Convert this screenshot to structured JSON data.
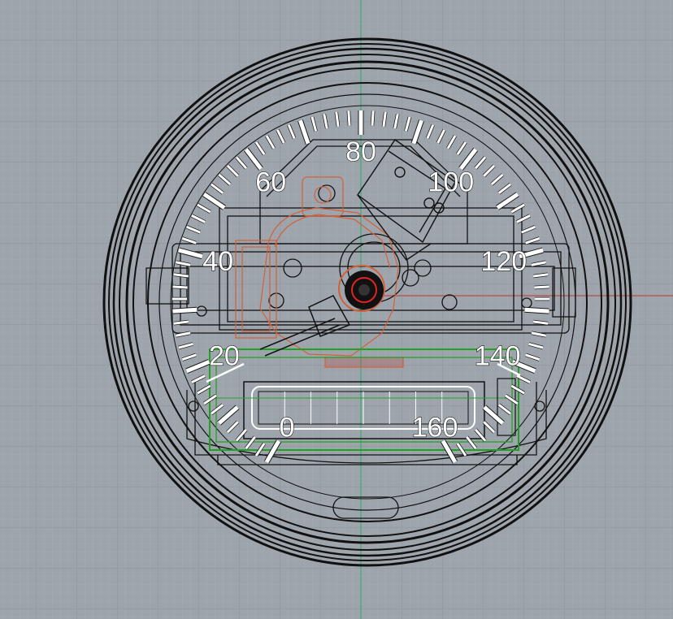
{
  "viewport": {
    "background": "#9ea4ac",
    "grid_minor": "#aab0b7",
    "grid_major": "#8d939b",
    "axis_x_color": "#c0392b",
    "axis_y_color": "#27ae60"
  },
  "gauge": {
    "labels": [
      "0",
      "20",
      "40",
      "60",
      "80",
      "100",
      "120",
      "140",
      "160"
    ],
    "values": [
      0,
      20,
      40,
      60,
      80,
      100,
      120,
      140,
      160
    ],
    "max_value": 160,
    "minor_tick_step": 2,
    "major_tick_step": 10,
    "tick_color": "#ffffff",
    "wire_color": "#111111",
    "mechanism_color": "#d2603a",
    "display_frame_color": "#1fa31f"
  }
}
